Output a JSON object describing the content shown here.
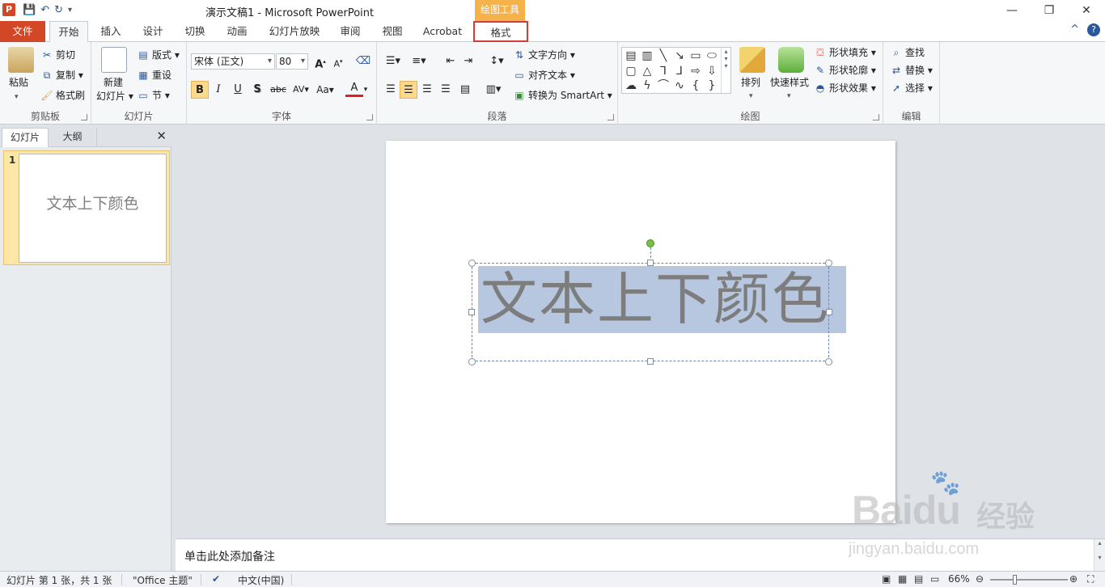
{
  "titlebar": {
    "app_icon": "P",
    "title": "演示文稿1 - Microsoft PowerPoint",
    "context_header": "绘图工具",
    "qat": [
      "save-icon",
      "undo-icon",
      "redo-icon",
      "customize-icon"
    ],
    "controls": {
      "minimize": "—",
      "restore": "❐",
      "close": "✕"
    }
  },
  "tabs": {
    "file": "文件",
    "home": "开始",
    "insert": "插入",
    "design": "设计",
    "transitions": "切换",
    "animations": "动画",
    "slideshow": "幻灯片放映",
    "review": "审阅",
    "view": "视图",
    "acrobat": "Acrobat",
    "format": "格式",
    "collapse": "^",
    "help": "?"
  },
  "ribbon": {
    "clipboard": {
      "label": "剪贴板",
      "paste": "粘贴",
      "cut": "剪切",
      "copy": "复制",
      "format_painter": "格式刷"
    },
    "slides": {
      "label": "幻灯片",
      "new_slide_1": "新建",
      "new_slide_2": "幻灯片",
      "layout": "版式",
      "reset": "重设",
      "section": "节"
    },
    "font": {
      "label": "字体",
      "font_name": "宋体 (正文)",
      "font_size": "80",
      "grow": "A",
      "shrink": "A",
      "bold": "B",
      "italic": "I",
      "underline": "U",
      "shadow": "S",
      "strike": "abc",
      "spacing": "AV",
      "case": "Aa",
      "color": "A"
    },
    "paragraph": {
      "label": "段落",
      "text_direction": "文字方向",
      "align_text": "对齐文本",
      "smartart": "转换为 SmartArt"
    },
    "drawing": {
      "label": "绘图",
      "arrange": "排列",
      "quick_styles": "快速样式",
      "shape_fill": "形状填充",
      "shape_outline": "形状轮廓",
      "shape_effects": "形状效果"
    },
    "editing": {
      "label": "编辑",
      "find": "查找",
      "replace": "替换",
      "select": "选择"
    }
  },
  "left_panel": {
    "tab_slides": "幻灯片",
    "tab_outline": "大纲",
    "close": "✕",
    "slide_number": "1",
    "thumb_text": "文本上下颜色"
  },
  "slide": {
    "text": "文本上下颜色"
  },
  "notes": {
    "placeholder": "单击此处添加备注"
  },
  "statusbar": {
    "slide_info": "幻灯片 第 1 张，共 1 张",
    "theme": "\"Office 主题\"",
    "language": "中文(中国)",
    "zoom": "66%"
  },
  "watermark": {
    "logo": "Baidu",
    "cn": "经验",
    "url": "jingyan.baidu.com"
  }
}
